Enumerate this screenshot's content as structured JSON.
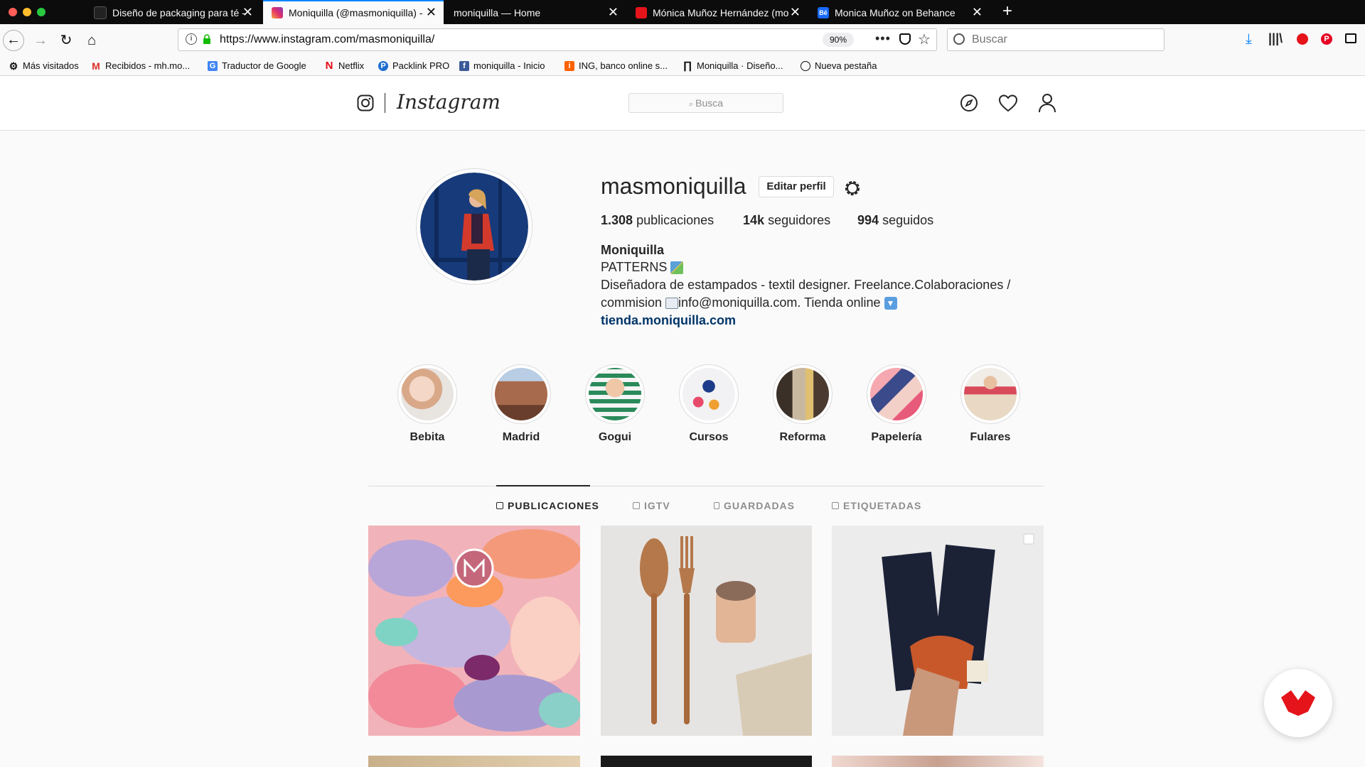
{
  "browser": {
    "tabs": [
      {
        "title": "Diseño de packaging para té -",
        "active": false
      },
      {
        "title": "Moniquilla (@masmoniquilla) -",
        "active": true
      },
      {
        "title": "moniquilla — Home",
        "active": false
      },
      {
        "title": "Mónica Muñoz Hernández (mo",
        "active": false
      },
      {
        "title": "Monica Muñoz on Behance",
        "active": false
      }
    ],
    "new_tab": "+",
    "url": "https://www.instagram.com/masmoniquilla/",
    "zoom": "90%",
    "search_placeholder": "Buscar",
    "bookmarks": [
      "Más visitados",
      "Recibidos - mh.mo...",
      "Traductor de Google",
      "Netflix",
      "Packlink PRO",
      "moniquilla - Inicio",
      "ING, banco online s...",
      "Moniquilla · Diseño...",
      "Nueva pestaña"
    ]
  },
  "instagram": {
    "wordmark": "Instagram",
    "search_placeholder": "Busca",
    "profile": {
      "username": "masmoniquilla",
      "edit_button": "Editar perfil",
      "stats": {
        "posts_count": "1.308",
        "posts_label": "publicaciones",
        "followers_count": "14k",
        "followers_label": "seguidores",
        "following_count": "994",
        "following_label": "seguidos"
      },
      "name": "Moniquilla",
      "bio_line1": "PATTERNS",
      "bio_line2": "Diseñadora de estampados - textil designer. Freelance.Colaboraciones /",
      "bio_line3": "commision",
      "bio_line3b": "info@moniquilla.com. Tienda online",
      "link": "tienda.moniquilla.com"
    },
    "highlights": [
      "Bebita",
      "Madrid",
      "Gogui",
      "Cursos",
      "Reforma",
      "Papelería",
      "Fulares"
    ],
    "tabs": [
      "PUBLICACIONES",
      "IGTV",
      "GUARDADAS",
      "ETIQUETADAS"
    ]
  },
  "colors": {
    "accent": "#0a84ff",
    "link": "#003569",
    "domestika": "#e5141b"
  }
}
